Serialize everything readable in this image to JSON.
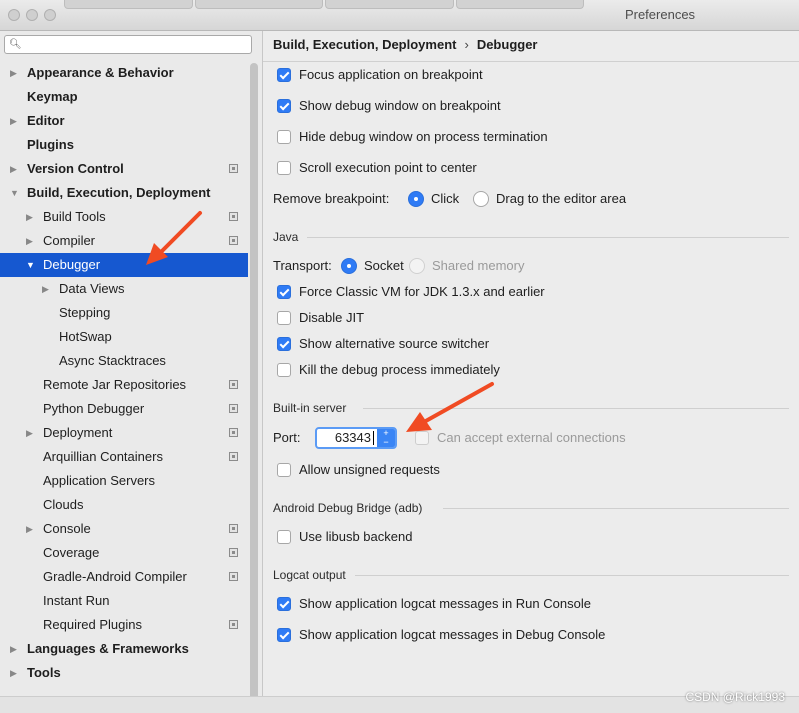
{
  "window": {
    "title": "Preferences"
  },
  "sidebar": {
    "search_placeholder": "",
    "items": [
      {
        "label": "Appearance & Behavior",
        "bold": true,
        "arrow": "right",
        "indent": 0
      },
      {
        "label": "Keymap",
        "bold": true,
        "arrow": "",
        "indent": 0
      },
      {
        "label": "Editor",
        "bold": true,
        "arrow": "right",
        "indent": 0
      },
      {
        "label": "Plugins",
        "bold": true,
        "arrow": "",
        "indent": 0
      },
      {
        "label": "Version Control",
        "bold": true,
        "arrow": "right",
        "indent": 0,
        "project": true
      },
      {
        "label": "Build, Execution, Deployment",
        "bold": true,
        "arrow": "down",
        "indent": 0
      },
      {
        "label": "Build Tools",
        "bold": false,
        "arrow": "right",
        "indent": 1,
        "project": true
      },
      {
        "label": "Compiler",
        "bold": false,
        "arrow": "right",
        "indent": 1,
        "project": true
      },
      {
        "label": "Debugger",
        "bold": false,
        "arrow": "down",
        "indent": 1,
        "selected": true
      },
      {
        "label": "Data Views",
        "bold": false,
        "arrow": "right",
        "indent": 2
      },
      {
        "label": "Stepping",
        "bold": false,
        "arrow": "",
        "indent": 2
      },
      {
        "label": "HotSwap",
        "bold": false,
        "arrow": "",
        "indent": 2
      },
      {
        "label": "Async Stacktraces",
        "bold": false,
        "arrow": "",
        "indent": 2
      },
      {
        "label": "Remote Jar Repositories",
        "bold": false,
        "arrow": "",
        "indent": 1,
        "project": true
      },
      {
        "label": "Python Debugger",
        "bold": false,
        "arrow": "",
        "indent": 1,
        "project": true
      },
      {
        "label": "Deployment",
        "bold": false,
        "arrow": "right",
        "indent": 1,
        "project": true
      },
      {
        "label": "Arquillian Containers",
        "bold": false,
        "arrow": "",
        "indent": 1,
        "project": true
      },
      {
        "label": "Application Servers",
        "bold": false,
        "arrow": "",
        "indent": 1
      },
      {
        "label": "Clouds",
        "bold": false,
        "arrow": "",
        "indent": 1
      },
      {
        "label": "Console",
        "bold": false,
        "arrow": "right",
        "indent": 1,
        "project": true
      },
      {
        "label": "Coverage",
        "bold": false,
        "arrow": "",
        "indent": 1,
        "project": true
      },
      {
        "label": "Gradle-Android Compiler",
        "bold": false,
        "arrow": "",
        "indent": 1,
        "project": true
      },
      {
        "label": "Instant Run",
        "bold": false,
        "arrow": "",
        "indent": 1
      },
      {
        "label": "Required Plugins",
        "bold": false,
        "arrow": "",
        "indent": 1,
        "project": true
      },
      {
        "label": "Languages & Frameworks",
        "bold": true,
        "arrow": "right",
        "indent": 0
      },
      {
        "label": "Tools",
        "bold": true,
        "arrow": "right",
        "indent": 0
      }
    ]
  },
  "breadcrumb": {
    "parent": "Build, Execution, Deployment",
    "separator": "›",
    "current": "Debugger"
  },
  "general": {
    "focus_app": {
      "label": "Focus application on breakpoint",
      "checked": true
    },
    "show_debug": {
      "label": "Show debug window on breakpoint",
      "checked": true
    },
    "hide_debug": {
      "label": "Hide debug window on process termination",
      "checked": false
    },
    "scroll_exec": {
      "label": "Scroll execution point to center",
      "checked": false
    },
    "remove_bp": {
      "label": "Remove breakpoint:",
      "opt_click": "Click",
      "opt_drag": "Drag to the editor area",
      "selected": "Click"
    }
  },
  "java": {
    "section": "Java",
    "transport_label": "Transport:",
    "socket": "Socket",
    "shared_memory": "Shared memory",
    "force_classic": {
      "label": "Force Classic VM for JDK 1.3.x and earlier",
      "checked": true
    },
    "disable_jit": {
      "label": "Disable JIT",
      "checked": false
    },
    "alt_source": {
      "label": "Show alternative source switcher",
      "checked": true
    },
    "kill_debug": {
      "label": "Kill the debug process immediately",
      "checked": false
    }
  },
  "builtin": {
    "section": "Built-in server",
    "port_label": "Port:",
    "port_value": "63343",
    "external": {
      "label": "Can accept external connections",
      "checked": false
    },
    "unsigned": {
      "label": "Allow unsigned requests",
      "checked": false
    }
  },
  "adb": {
    "section": "Android Debug Bridge (adb)",
    "libusb": {
      "label": "Use libusb backend",
      "checked": false
    }
  },
  "logcat": {
    "section": "Logcat output",
    "run": {
      "label": "Show application logcat messages in Run Console",
      "checked": true
    },
    "debug": {
      "label": "Show application logcat messages in Debug Console",
      "checked": true
    }
  },
  "watermark": "CSDN @Rick1993",
  "colors": {
    "accent": "#2f7bf5",
    "selection": "#1658d0",
    "annotation": "#f04b23"
  }
}
